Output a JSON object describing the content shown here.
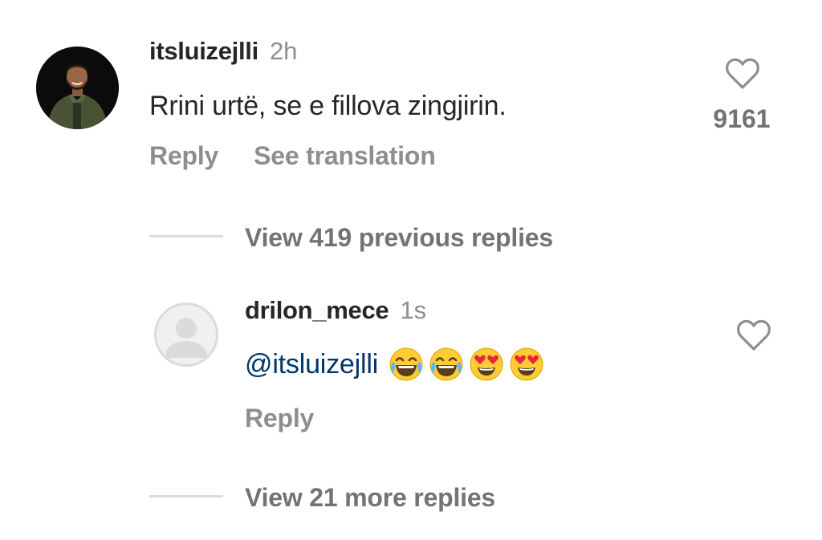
{
  "comment": {
    "username": "itsluizejlli",
    "time": "2h",
    "text": "Rrini urtë, se e fillova zingjirin.",
    "like_count": "9161",
    "actions": {
      "reply": "Reply",
      "translate": "See translation"
    },
    "avatar_icon": "profile-photo"
  },
  "view_previous": "View 419 previous replies",
  "reply": {
    "username": "drilon_mece",
    "time": "1s",
    "mention": "@itsluizejlli",
    "emojis": [
      "face-with-tears-of-joy",
      "face-with-tears-of-joy",
      "smiling-face-with-heart-eyes",
      "smiling-face-with-heart-eyes"
    ],
    "action_reply": "Reply",
    "avatar_icon": "default-avatar-icon"
  },
  "view_more": "View 21 more replies",
  "colors": {
    "primary_text": "#262626",
    "secondary_text": "#8e8e8e",
    "mention": "#00376b",
    "divider": "#dbdbdb"
  }
}
